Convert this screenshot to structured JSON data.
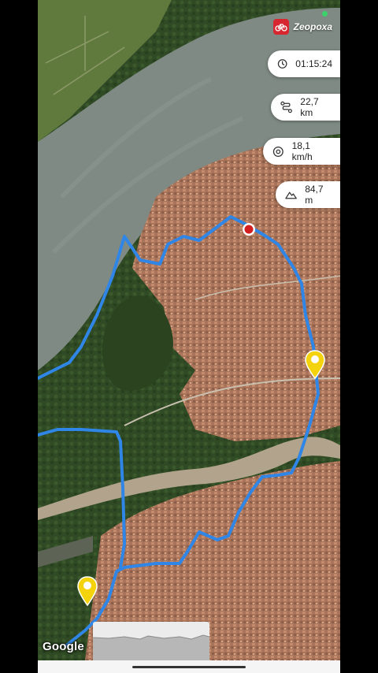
{
  "app": {
    "brand": "Zeopoxa",
    "brand_icon": "bicycle-icon",
    "brand_color": "#d7262f"
  },
  "stats": {
    "duration": {
      "value": "01:15:24",
      "icon": "clock-icon"
    },
    "distance": {
      "value": "22,7 km",
      "icon": "route-icon"
    },
    "avg_speed": {
      "value": "18,1 km/h",
      "icon": "speedometer-icon"
    },
    "elevation": {
      "value": "84,7 m",
      "icon": "mountain-icon"
    }
  },
  "map": {
    "attribution": "Google",
    "map_type": "satellite",
    "route_color": "#2f86e6",
    "markers": [
      "start-marker-red",
      "waypoint-marker-yellow",
      "waypoint-marker-yellow"
    ]
  },
  "elevation_profile": {
    "visible": true
  }
}
